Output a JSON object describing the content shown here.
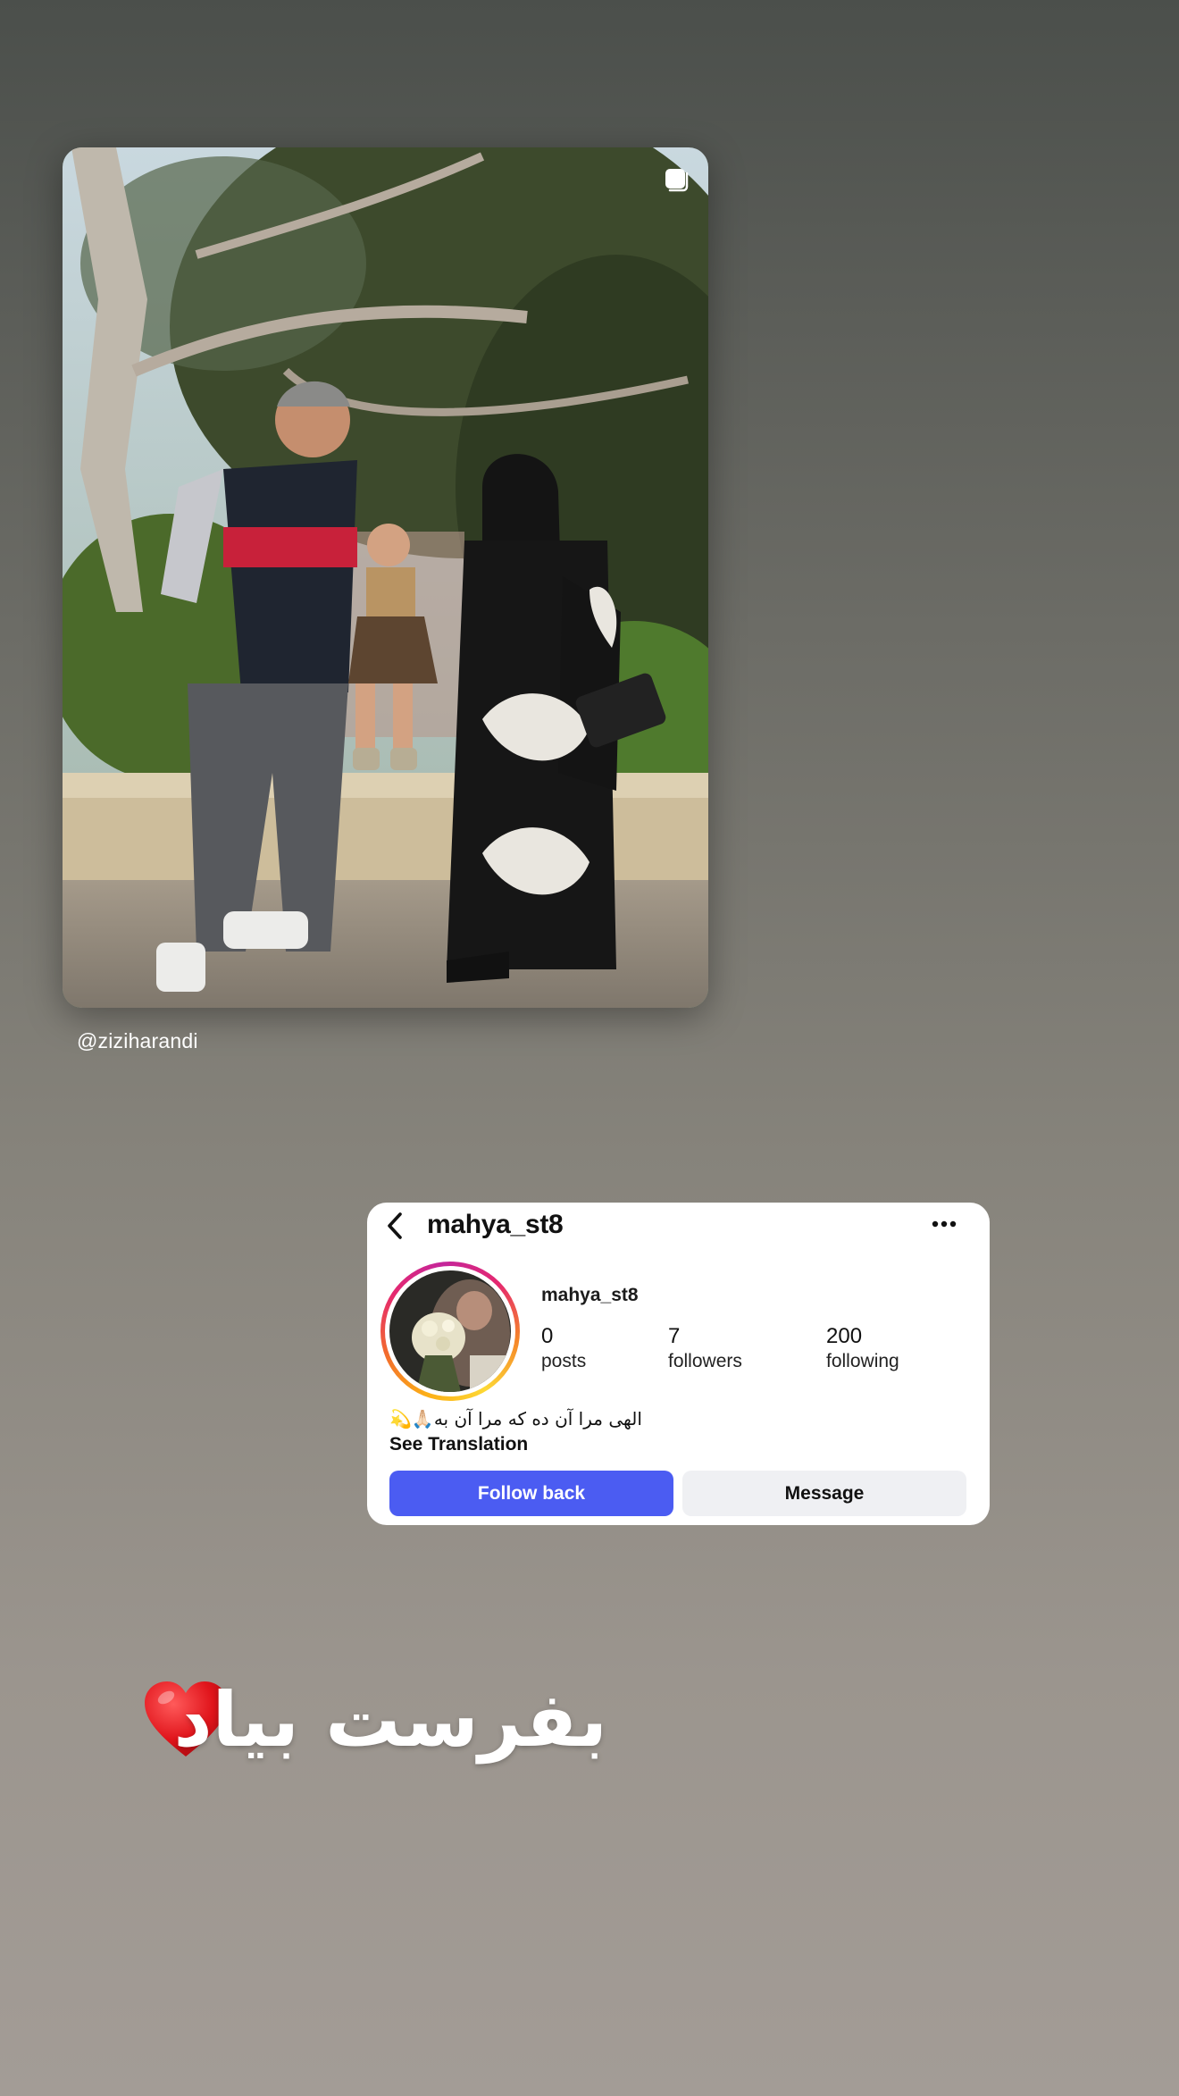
{
  "post": {
    "credit": "@ziziharandi",
    "multi_icon": "carousel-square-icon"
  },
  "profile_card": {
    "header_username": "mahya_st8",
    "name": "mahya_st8",
    "stats": {
      "posts_count": "0",
      "posts_label": "posts",
      "followers_count": "7",
      "followers_label": "followers",
      "following_count": "200",
      "following_label": "following"
    },
    "bio": "💫🙏🏻الهی مرا آن ده که مرا آن به",
    "see_translation": "See Translation",
    "follow_back_label": "Follow back",
    "message_label": "Message",
    "colors": {
      "follow_button": "#4b5cf2",
      "message_button": "#eff0f3"
    }
  },
  "caption": {
    "text": "بفرست بیاد",
    "heart": "red-heart-icon"
  }
}
